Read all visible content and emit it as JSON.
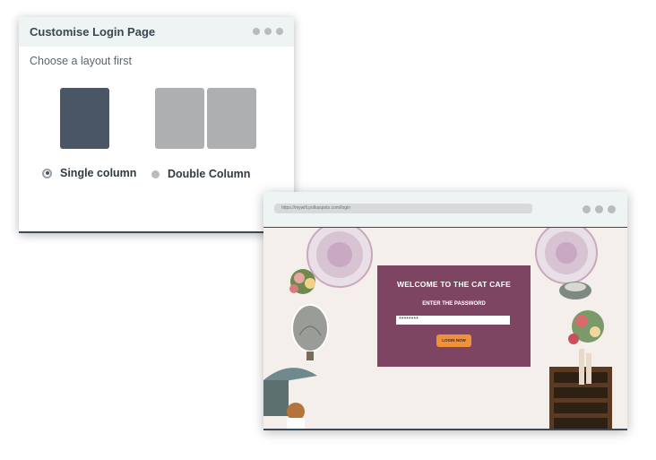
{
  "customise_window": {
    "title": "Customise Login Page",
    "subtitle": "Choose a layout first",
    "options": [
      {
        "label": "Single column",
        "selected": true
      },
      {
        "label": "Double Column",
        "selected": false
      }
    ],
    "colors": {
      "single_thumb": "#4a5566",
      "double_thumb": "#aeafb1"
    }
  },
  "preview_window": {
    "url": "https://mywifi.polkaspots.com/login",
    "panel_title": "WELCOME TO THE CAT CAFE",
    "password_label": "ENTER THE PASSWORD",
    "password_value": "********",
    "button_label": "LOGIN NOW",
    "colors": {
      "panel": "#7e4563",
      "button": "#f0913a",
      "background": "#f4efea"
    }
  }
}
